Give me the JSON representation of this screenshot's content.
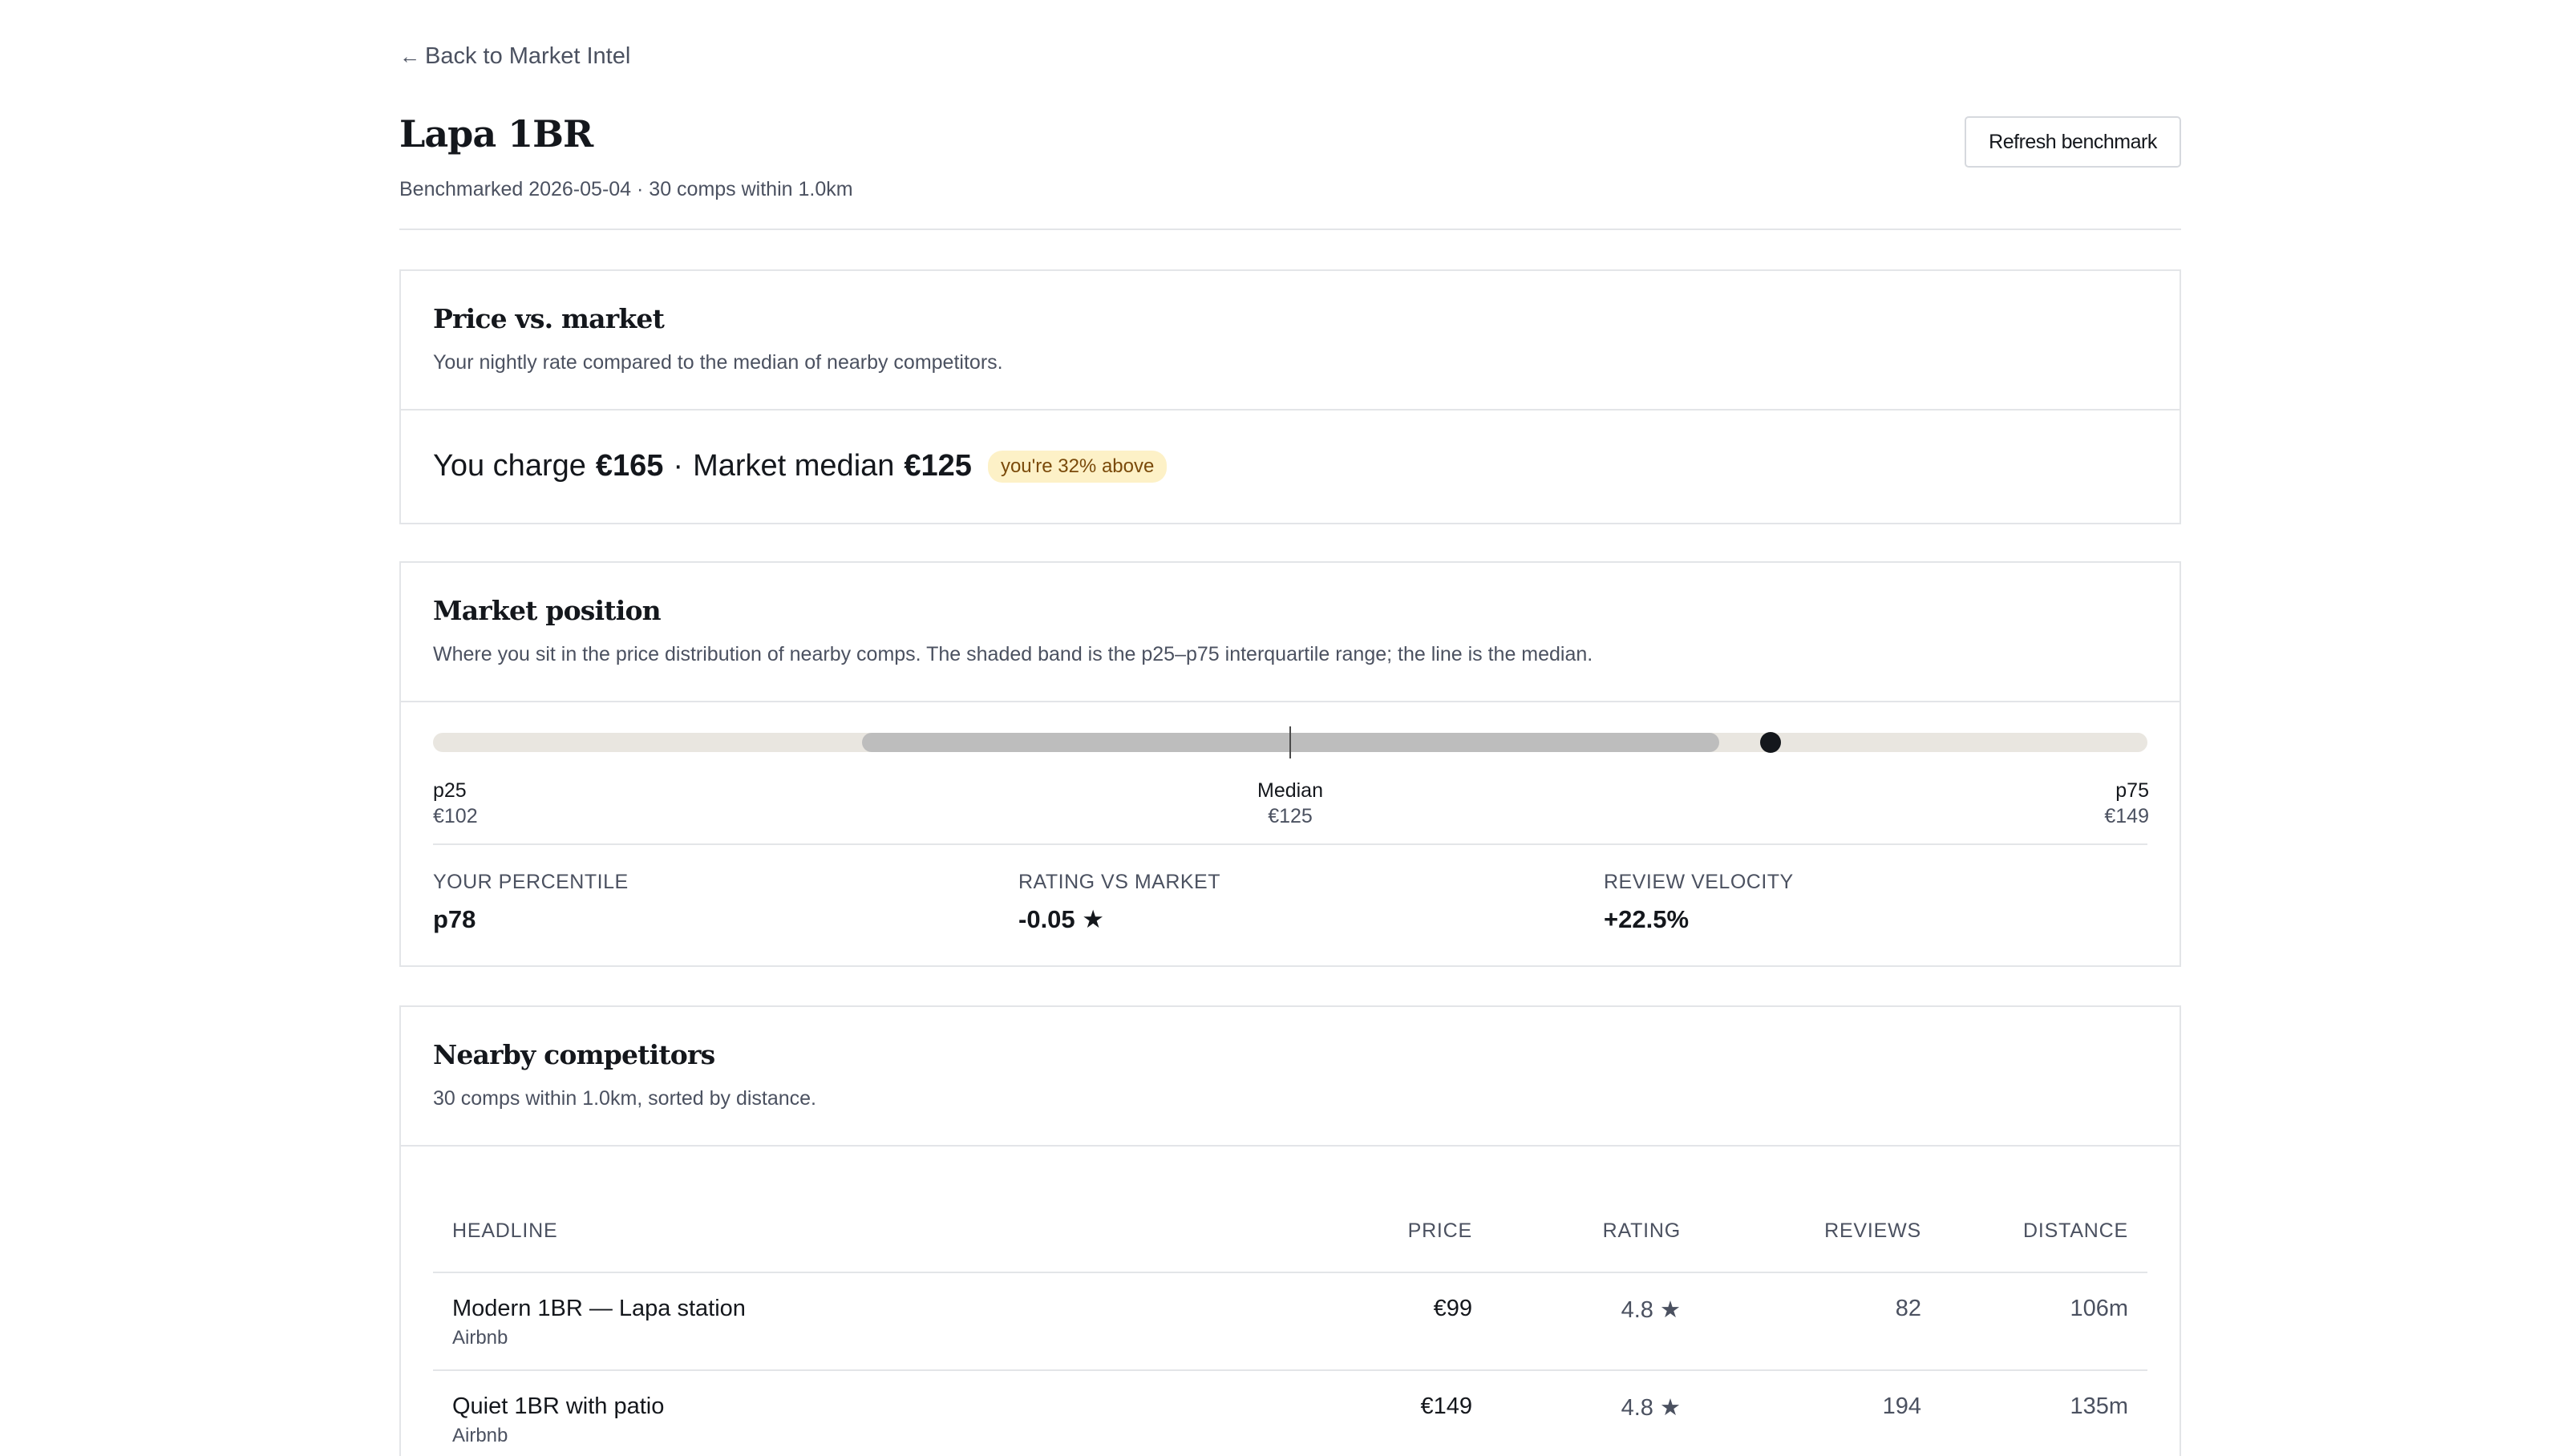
{
  "nav": {
    "back_arrow": "←",
    "back_label": "Back to Market Intel"
  },
  "header": {
    "title": "Lapa 1BR",
    "subtitle": "Benchmarked 2026-05-04 · 30 comps within 1.0km",
    "refresh_label": "Refresh benchmark"
  },
  "price_card": {
    "title": "Price vs. market",
    "description": "Your nightly rate compared to the median of nearby competitors.",
    "you_charge_label": "You charge",
    "you_charge_value": "€165",
    "separator": "·",
    "median_label": "Market median",
    "median_value": "€125",
    "badge": "you're 32% above"
  },
  "market_card": {
    "title": "Market position",
    "description": "Where you sit in the price distribution of nearby comps. The shaded band is the p25–p75 interquartile range; the line is the median.",
    "range": {
      "iqr_start_fraction": 0.25,
      "iqr_end_fraction": 0.75,
      "median_fraction": 0.5,
      "you_fraction": 0.78
    },
    "p25_label": "p25",
    "p25_value": "€102",
    "median_label": "Median",
    "median_value": "€125",
    "p75_label": "p75",
    "p75_value": "€149",
    "stats": [
      {
        "label": "Your percentile",
        "value": "p78"
      },
      {
        "label": "Rating vs market",
        "value": "-0.05 ★"
      },
      {
        "label": "Review velocity",
        "value": "+22.5%"
      }
    ]
  },
  "comps_card": {
    "title": "Nearby competitors",
    "description": "30 comps within 1.0km, sorted by distance.",
    "columns": {
      "headline": "Headline",
      "price": "Price",
      "rating": "Rating",
      "reviews": "Reviews",
      "distance": "Distance"
    },
    "rows": [
      {
        "headline": "Modern 1BR — Lapa station",
        "source": "Airbnb",
        "price": "€99",
        "rating": "4.8 ★",
        "reviews": "82",
        "distance": "106m"
      },
      {
        "headline": "Quiet 1BR with patio",
        "source": "Airbnb",
        "price": "€149",
        "rating": "4.8 ★",
        "reviews": "194",
        "distance": "135m"
      }
    ]
  }
}
